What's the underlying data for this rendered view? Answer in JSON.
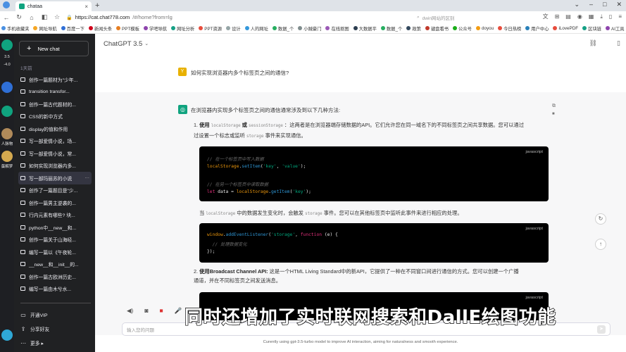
{
  "browser": {
    "tab_title": "chataa",
    "tab_close": "×",
    "new_tab": "+",
    "url_host": "https://cat.chat778.com",
    "url_path": "/#/home?from=lg",
    "search_placeholder": "dwin网站的区别"
  },
  "bookmarks": [
    {
      "label": "手机收藏夹",
      "color": "#4a90e2"
    },
    {
      "label": "网址导航",
      "color": "#f5a623"
    },
    {
      "label": "百度一下",
      "color": "#2f6fd6"
    },
    {
      "label": "新闻头条",
      "color": "#d0021b"
    },
    {
      "label": "PPT模板",
      "color": "#e67e22"
    },
    {
      "label": "学吧导航",
      "color": "#8e44ad"
    },
    {
      "label": "网址分析",
      "color": "#16a085"
    },
    {
      "label": "PPT资源",
      "color": "#e74c3c"
    },
    {
      "label": "设计",
      "color": "#95a5a6"
    },
    {
      "label": "人的网址",
      "color": "#3498db"
    },
    {
      "label": "数据_个",
      "color": "#27ae60"
    },
    {
      "label": "小贼豪门",
      "color": "#7f8c8d"
    },
    {
      "label": "在线抠图",
      "color": "#9b59b6"
    },
    {
      "label": "大数据平",
      "color": "#2c3e50"
    },
    {
      "label": "数据_个",
      "color": "#27ae60"
    },
    {
      "label": "政策",
      "color": "#34495e"
    },
    {
      "label": "键盘看书",
      "color": "#c0392b"
    },
    {
      "label": "公众号",
      "color": "#1aad19"
    },
    {
      "label": "doyou",
      "color": "#f39c12"
    },
    {
      "label": "今日热榜",
      "color": "#e74c3c"
    },
    {
      "label": "用户中心",
      "color": "#2980b9"
    },
    {
      "label": "iLovePDF",
      "color": "#e74c3c"
    },
    {
      "label": "区块链",
      "color": "#16a085"
    },
    {
      "label": "AI工具",
      "color": "#8e44ad"
    }
  ],
  "strip": {
    "labels": [
      "3.5",
      "-4.0",
      "人脉物",
      "蛋解梦"
    ]
  },
  "sidebar": {
    "new_chat": "New chat",
    "section": "1天前",
    "chats": [
      "创作一篇题材为\"少年...",
      "transition transfor...",
      "创作一篇古代题材的...",
      "CSS的新中方式",
      "display的值和作用",
      "写一部爱情小说，场...",
      "写一部爱情小说，常...",
      "如何实现浏览器内多...",
      "写一部玛丽苏的小说",
      "创作了一篇题目是\"少...",
      "创作一篇男主逆袭的...",
      "行内元素有哪些? 块...",
      "python中__new__和...",
      "创作一篇关于山海经...",
      "编写一篇以《午夜轮...",
      "__new__和__init__的...",
      "创作一篇古欧洲历史...",
      "编写一篇由木兮水..."
    ],
    "active_index": 8,
    "more": "···",
    "bottom": [
      {
        "icon": "▭",
        "label": "开通VIP"
      },
      {
        "icon": "⇪",
        "label": "分享好友"
      },
      {
        "icon": "⋯",
        "label": "更多 ▸"
      }
    ]
  },
  "main": {
    "model": "ChatGPT 3.5",
    "caret": "⌄",
    "user_initial": "Y",
    "user_question": "如何实现浏览器内多个标签页之间的通信?",
    "ai_initial": "◎",
    "ai_intro": "在浏览器内实现多个标签页之间的通信通常涉及到以下几种方法:",
    "p1_num": "1.",
    "p1_lead": "使用",
    "p1_code1": "localStorage",
    "p1_or": "或",
    "p1_code2": "sessionStorage",
    "p1_text": "：这两者是在浏览器端存储数据的API。它们允许您在同一域名下的不同标签页之间共享数据。您可以通过",
    "p1_text2": "过设置一个标志或监听",
    "p1_code3": "storage",
    "p1_text3": "事件来实现通信。",
    "code1_lang": "javascript",
    "code1": [
      "// 在一个标签页中写入数据",
      "localStorage.setItem('key', 'value');",
      "",
      "// 在另一个标签页中读取数据",
      "let data = localStorage.getItem('key');"
    ],
    "p2_a": "当",
    "p2_code": "localStorage",
    "p2_b": "中的数据发生变化时，会触发",
    "p2_code2": "storage",
    "p2_c": "事件。您可以在其他标签页中监听此事件来进行相应的处理。",
    "code2_lang": "javascript",
    "code2": [
      "window.addEventListener('storage', function (e) {",
      "  // 处理数据变化",
      "});"
    ],
    "p3_num": "2.",
    "p3_lead": "使用Broadcast Channel API:",
    "p3_text": "这是一个HTML Living Standard中的新API，它提供了一种在不同窗口间进行通信的方式。您可以创建一个广播",
    "p3_text2": "通道，并在不同标签页之间发送消息。",
    "code3_lang": "javascript",
    "input_placeholder": "输入您的问题",
    "send": "➤",
    "footer": "Curently using gpt-3.5-turbo model to improve AI interaction, aiming for naturalness and smooth experience.",
    "subtitle": "同时还增加了实时联网搜索和DallE绘图功能"
  }
}
